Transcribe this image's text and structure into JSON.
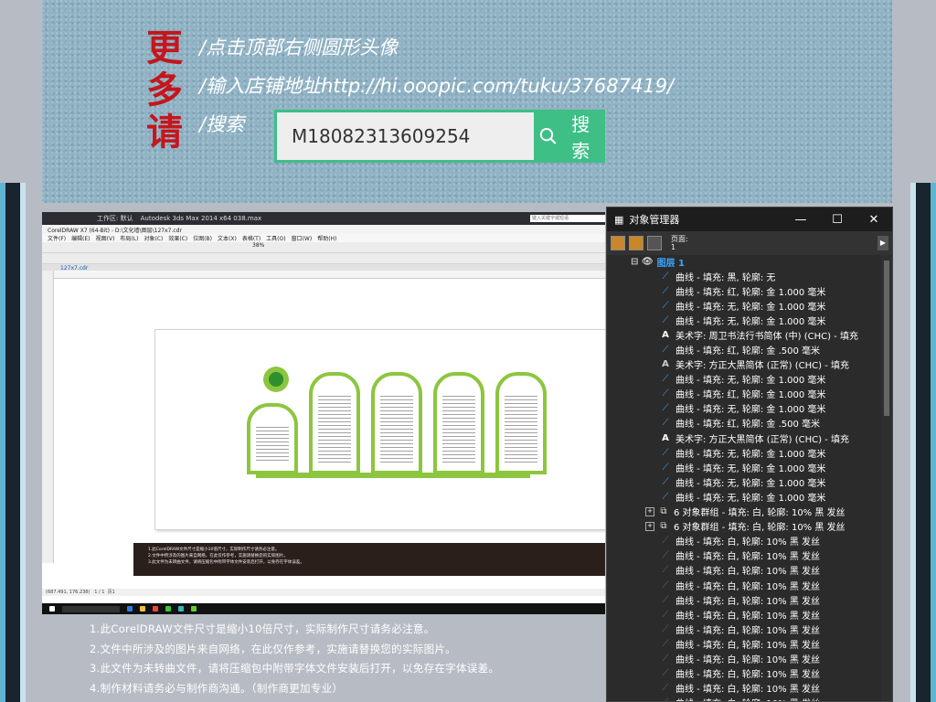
{
  "banner": {
    "calligraphy": [
      "更",
      "多",
      "请"
    ],
    "lines": [
      "/点击顶部右侧圆形头像",
      "/输入店铺地址http://hi.ooopic.com/tuku/37687419/",
      "/搜索"
    ],
    "search_value": "M18082313609254",
    "search_button": "搜索"
  },
  "corel": {
    "max_bar_title": "Autodesk 3ds Max  2014 x64      038.max",
    "max_search_placeholder": "键入关键字或短语",
    "workspace": "工作区: 默认",
    "title": "CorelDRAW X7 (64-Bit) - D:\\文化墙\\图层\\127x7.cdr",
    "menu": [
      "文件(F)",
      "编辑(E)",
      "视图(V)",
      "布局(L)",
      "对象(C)",
      "效果(C)",
      "位图(B)",
      "文本(X)",
      "表格(T)",
      "工具(O)",
      "窗口(W)",
      "帮助(H)"
    ],
    "doc_tab": "127x7.cdr",
    "zoom": "38%",
    "zhizuo": "制作",
    "notes": [
      "1.此CorelDRAW文件尺寸是缩小10倍尺寸，实际制作尺寸请务必注意。",
      "2.文件中所涉及的图片来自网络，在此仅作参考，实施请替换您的实际图片。",
      "3.此文件为未转曲文件，请将压缩包中附带字体文件安装后打开，以免存在字体误差。"
    ],
    "status": "(687.491, 176.238)",
    "page_label": "页1",
    "page_count": "1 / 1"
  },
  "notes_below": [
    "1.此CorelDRAW文件尺寸是缩小10倍尺寸，实际制作尺寸请务必注意。",
    "2.文件中所涉及的图片来自网络，在此仅作参考，实施请替换您的实际图片。",
    "3.此文件为未转曲文件，请将压缩包中附带字体文件安装后打开，以免存在字体误差。",
    "4.制作材料请务必与制作商沟通。（制作商更加专业）"
  ],
  "object_manager": {
    "title": "对象管理器",
    "page": "页面:",
    "page_num": "1",
    "layer": "图层 1",
    "items": [
      {
        "type": "curve",
        "label": "曲线 - 填充: 黑, 轮廓: 无"
      },
      {
        "type": "curve",
        "label": "曲线 - 填充: 红, 轮廓: 金  1.000 毫米"
      },
      {
        "type": "curve",
        "label": "曲线 - 填充: 无, 轮廓: 金  1.000 毫米"
      },
      {
        "type": "curve",
        "label": "曲线 - 填充: 无, 轮廓: 金  1.000 毫米"
      },
      {
        "type": "text",
        "label": "美术字:  周卫书法行书简体 (中) (CHC) - 填充"
      },
      {
        "type": "curve",
        "label": "曲线 - 填充: 红, 轮廓: 金  .500 毫米"
      },
      {
        "type": "text-faint",
        "label": "美术字:  方正大黑简体 (正常) (CHC) - 填充"
      },
      {
        "type": "curve",
        "label": "曲线 - 填充: 无, 轮廓: 金  1.000 毫米"
      },
      {
        "type": "curve",
        "label": "曲线 - 填充: 红, 轮廓: 金  1.000 毫米"
      },
      {
        "type": "curve",
        "label": "曲线 - 填充: 无, 轮廓: 金  1.000 毫米"
      },
      {
        "type": "curve",
        "label": "曲线 - 填充: 红, 轮廓: 金  .500 毫米"
      },
      {
        "type": "text",
        "label": "美术字:  方正大黑简体 (正常) (CHC) - 填充"
      },
      {
        "type": "curve",
        "label": "曲线 - 填充: 无, 轮廓: 金  1.000 毫米"
      },
      {
        "type": "curve",
        "label": "曲线 - 填充: 无, 轮廓: 金  1.000 毫米"
      },
      {
        "type": "curve",
        "label": "曲线 - 填充: 无, 轮廓: 金  1.000 毫米"
      },
      {
        "type": "curve",
        "label": "曲线 - 填充: 无, 轮廓: 金  1.000 毫米"
      },
      {
        "type": "group",
        "label": "6 对象群组 - 填充: 白, 轮廓: 10% 黑 发丝"
      },
      {
        "type": "group",
        "label": "6 对象群组 - 填充: 白, 轮廓: 10% 黑 发丝"
      },
      {
        "type": "dim",
        "label": "曲线 - 填充: 白, 轮廓: 10% 黑 发丝"
      },
      {
        "type": "dim",
        "label": "曲线 - 填充: 白, 轮廓: 10% 黑 发丝"
      },
      {
        "type": "dim",
        "label": "曲线 - 填充: 白, 轮廓: 10% 黑 发丝"
      },
      {
        "type": "dim",
        "label": "曲线 - 填充: 白, 轮廓: 10% 黑 发丝"
      },
      {
        "type": "dim",
        "label": "曲线 - 填充: 白, 轮廓: 10% 黑 发丝"
      },
      {
        "type": "dim",
        "label": "曲线 - 填充: 白, 轮廓: 10% 黑 发丝"
      },
      {
        "type": "dim",
        "label": "曲线 - 填充: 白, 轮廓: 10% 黑 发丝"
      },
      {
        "type": "dim",
        "label": "曲线 - 填充: 白, 轮廓: 10% 黑 发丝"
      },
      {
        "type": "dim",
        "label": "曲线 - 填充: 白, 轮廓: 10% 黑 发丝"
      },
      {
        "type": "dim",
        "label": "曲线 - 填充: 白, 轮廓: 10% 黑 发丝"
      },
      {
        "type": "dim",
        "label": "曲线 - 填充: 白, 轮廓: 10% 黑 发丝"
      },
      {
        "type": "dim",
        "label": "曲线 - 填充: 白, 轮廓: 10% 黑 发丝"
      }
    ]
  },
  "colors": {
    "accent_green": "#3dbf86",
    "design_green": "#8cc63e",
    "calligraphy_red": "#c4161c",
    "layer_blue": "#3aa7ff"
  },
  "icons": {
    "curve": "curve-icon",
    "text": "artistic-text-icon",
    "group": "group-icon",
    "search": "search-icon"
  }
}
